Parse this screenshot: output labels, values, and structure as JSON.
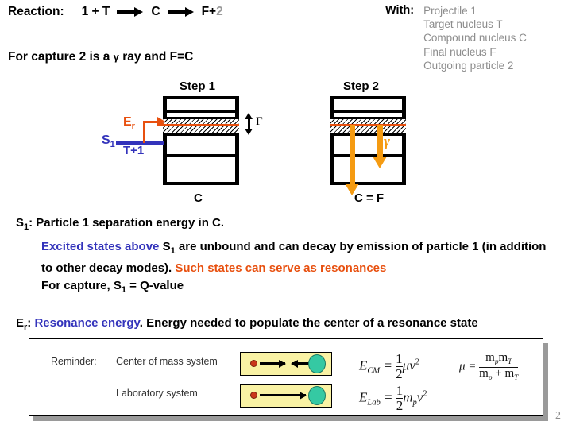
{
  "header": {
    "reaction_label": "Reaction:",
    "reaction_terms": [
      {
        "text": "1 + T",
        "dim": false
      },
      {
        "text": "C",
        "dim": false
      }
    ],
    "reaction_final_head": "F+",
    "reaction_final_tail": "2",
    "capture_note_pre": "For capture 2 is a ",
    "capture_note_gamma": "γ",
    "capture_note_post": " ray and F=C"
  },
  "with_block": {
    "label": "With:",
    "items": [
      "Projectile 1",
      "Target nucleus T",
      "Compound nucleus C",
      "Final nucleus F",
      "Outgoing particle 2"
    ]
  },
  "diagrams": {
    "step1": {
      "title": "Step 1",
      "caption": "C",
      "s1_label": "S",
      "s1_sub": "1",
      "tplus1_label": "T+1",
      "er_label": "E",
      "er_sub": "r",
      "width_label": "Γ"
    },
    "step2": {
      "title": "Step 2",
      "caption": "C = F",
      "gamma_label": "γ"
    }
  },
  "body": {
    "separation_energy": {
      "s": "S",
      "sub": "1",
      "rest": ": Particle 1 separation energy in C."
    },
    "excited": {
      "blue_part": "Excited states above ",
      "s": "S",
      "sub": "1",
      "black_part": " are unbound and can decay by emission of particle 1 (in addition to other decay modes). ",
      "orange_part": "Such states can serve as resonances"
    },
    "capture_q": {
      "pre": "For capture, S",
      "sub": "1",
      "post": " = Q-value"
    },
    "resonance_energy": {
      "e": "E",
      "sub": "r",
      "colon": ": ",
      "blue_part": "Resonance energy",
      "black_part": ". Energy needed to populate the center of a resonance state"
    }
  },
  "reminder": {
    "label": "Reminder:",
    "cm_label": "Center of mass system",
    "lab_label": "Laboratory system"
  },
  "equations": {
    "ecm": {
      "lhs": "E",
      "lhs_sub": "CM",
      "eq": " = ",
      "num": "1",
      "den": "2",
      "rhs": "μv",
      "sup": "2"
    },
    "elab": {
      "lhs": "E",
      "lhs_sub": "Lab",
      "eq": " = ",
      "num": "1",
      "den": "2",
      "rhs": "m",
      "rhs_sub": "p",
      "rhs2": "v",
      "sup": "2"
    },
    "mu": {
      "lhs": "μ",
      "eq": " = ",
      "num_a": "m",
      "num_a_sub": "p",
      "num_b": "m",
      "num_b_sub": "T",
      "den_a": "m",
      "den_a_sub": "p",
      "den_plus": " + ",
      "den_b": "m",
      "den_b_sub": "T"
    }
  },
  "footer": {
    "page_number": "2"
  },
  "colors": {
    "blue": "#3333bb",
    "orange_red": "#e8500f",
    "amber": "#f59b12",
    "yellow_panel": "#f9f2a4",
    "green_ball": "#35c9a3",
    "red_dot": "#c9361b",
    "gray_text": "#8c8c8c"
  }
}
